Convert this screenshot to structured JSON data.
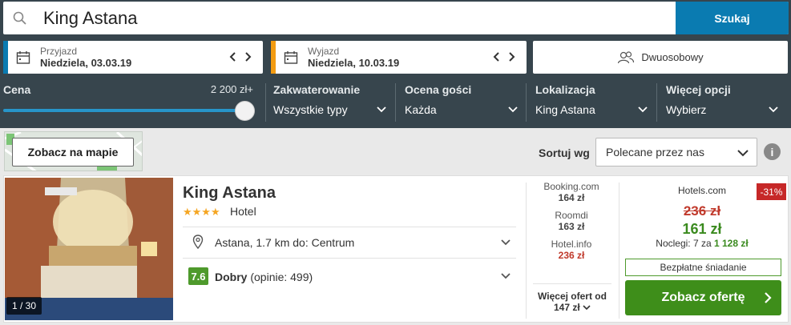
{
  "search": {
    "query": "King Astana",
    "button_label": "Szukaj"
  },
  "dates": {
    "checkin": {
      "label": "Przyjazd",
      "value": "Niedziela, 03.03.19",
      "accent": "#0a7bb1"
    },
    "checkout": {
      "label": "Wyjazd",
      "value": "Niedziela, 10.03.19",
      "accent": "#f39c12"
    }
  },
  "guests": {
    "label": "Dwuosobowy"
  },
  "filters": {
    "price": {
      "title": "Cena",
      "max_label": "2 200 zł+",
      "fill_fraction": 1.0
    },
    "accommodation": {
      "title": "Zakwaterowanie",
      "value": "Wszystkie typy"
    },
    "rating": {
      "title": "Ocena gości",
      "value": "Każda"
    },
    "location": {
      "title": "Lokalizacja",
      "value": "King Astana"
    },
    "more": {
      "title": "Więcej opcji",
      "value": "Wybierz"
    }
  },
  "map": {
    "button_label": "Zobacz na mapie"
  },
  "sort": {
    "label": "Sortuj wg",
    "selected": "Polecane przez nas"
  },
  "info_icon": "i",
  "hotel": {
    "photo_counter": "1 / 30",
    "name": "King Astana",
    "stars": "★★★★",
    "type": "Hotel",
    "location": "Astana, 1.7 km do: Centrum",
    "rating_score": "7.6",
    "rating_word": "Dobry",
    "rating_reviews": "(opinie: 499)",
    "offers": [
      {
        "site": "Booking.com",
        "price": "164 zł",
        "highlight": false
      },
      {
        "site": "Roomdi",
        "price": "163 zł",
        "highlight": false
      },
      {
        "site": "Hotel.info",
        "price": "236 zł",
        "highlight": true
      }
    ],
    "more_offers_line1": "Więcej ofert od",
    "more_offers_line2": "147 zł",
    "best": {
      "site": "Hotels.com",
      "discount": "-31%",
      "old_price": "236 zł",
      "new_price": "161 zł",
      "nights_prefix": "Noclegi: 7 za",
      "nights_total": "1 128 zł",
      "breakfast": "Bezpłatne śniadanie",
      "cta_label": "Zobacz ofertę"
    }
  },
  "colors": {
    "primary": "#0a7bb1",
    "cta_green": "#3e8e1a",
    "discount_red": "#c62828",
    "filter_bg": "#37454d"
  }
}
